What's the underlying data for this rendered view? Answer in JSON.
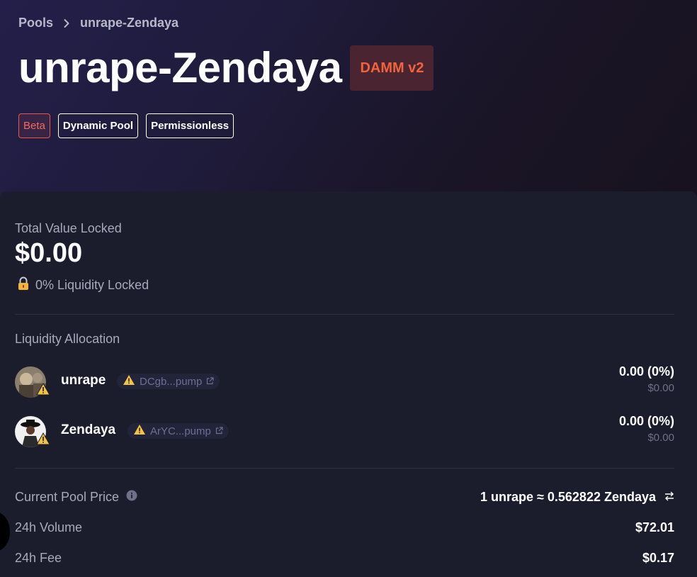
{
  "breadcrumb": {
    "root": "Pools",
    "current": "unrape-Zendaya"
  },
  "header": {
    "title": "unrape-Zendaya",
    "pool_type_badge": "DAMM v2",
    "tags": [
      "Beta",
      "Dynamic Pool",
      "Permissionless"
    ]
  },
  "tvl": {
    "label": "Total Value Locked",
    "value": "$0.00",
    "locked_text": "0% Liquidity Locked"
  },
  "liquidity": {
    "label": "Liquidity Allocation",
    "tokens": [
      {
        "name": "unrape",
        "address": "DCgb...pump",
        "amount": "0.00 (0%)",
        "usd": "$0.00"
      },
      {
        "name": "Zendaya",
        "address": "ArYC...pump",
        "amount": "0.00 (0%)",
        "usd": "$0.00"
      }
    ]
  },
  "stats": {
    "price_label": "Current Pool Price",
    "price_value": "1 unrape ≈ 0.562822 Zendaya",
    "volume_label": "24h Volume",
    "volume_value": "$72.01",
    "fee_label": "24h Fee",
    "fee_value": "$0.17"
  },
  "colors": {
    "accent_orange": "#f0633f",
    "beta_red": "#e8574f",
    "warning_yellow": "#f3c443",
    "card_bg": "#1b1d2c"
  },
  "icons": [
    "chevron-right-icon",
    "lock-icon",
    "warning-icon",
    "external-link-icon",
    "info-icon",
    "swap-arrows-icon"
  ]
}
